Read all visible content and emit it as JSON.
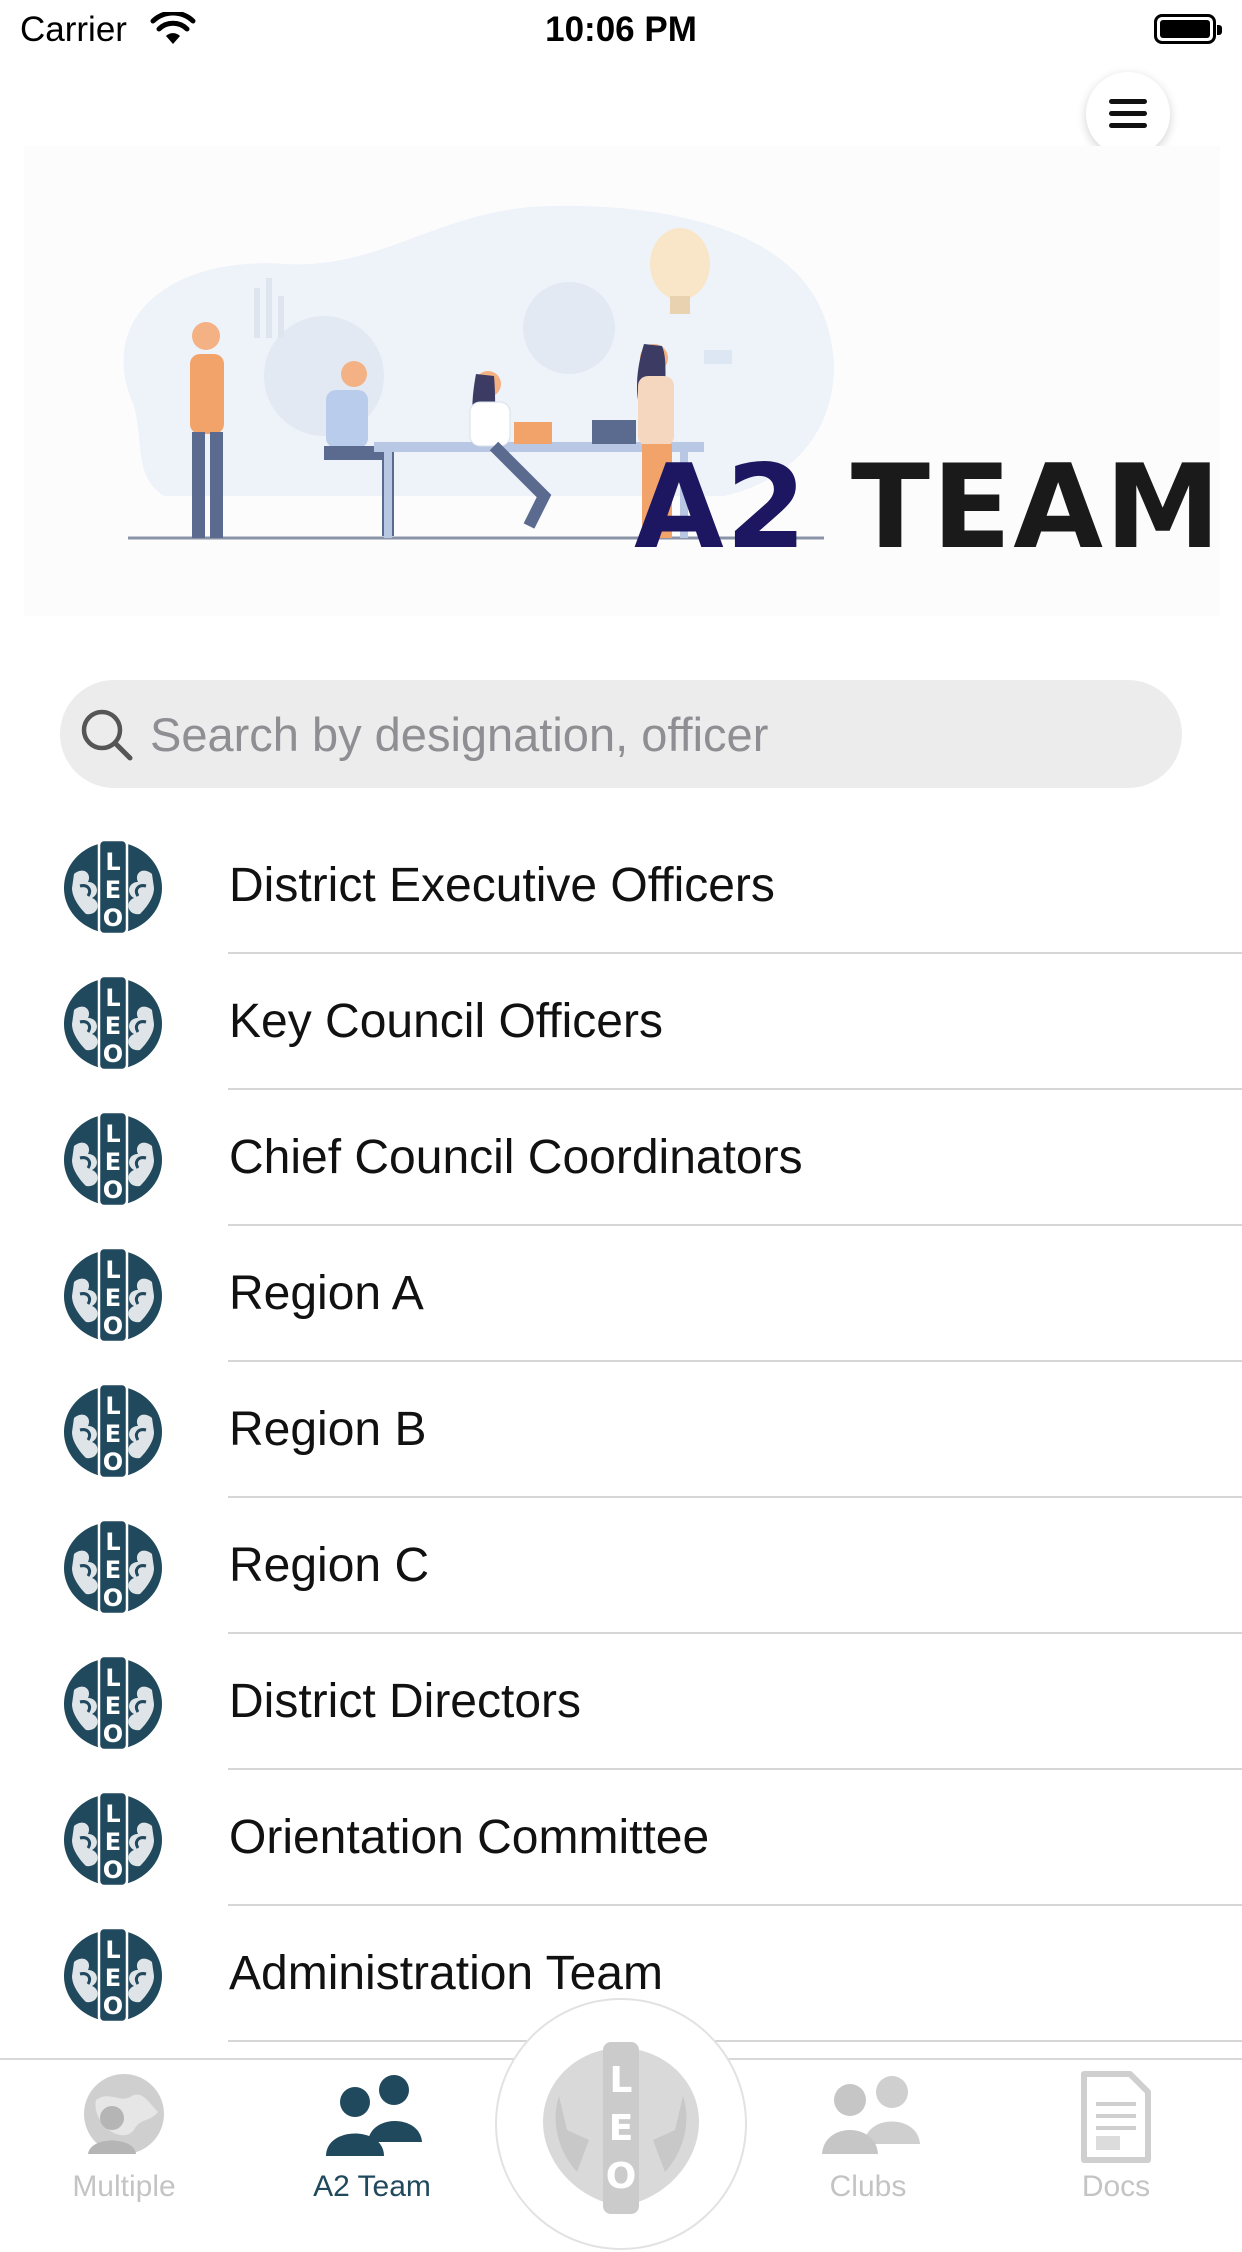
{
  "status_bar": {
    "carrier": "Carrier",
    "time": "10:06 PM"
  },
  "header": {
    "menu_icon": "hamburger-menu-icon"
  },
  "banner": {
    "title_part1": "A2",
    "title_part2": "TEAM"
  },
  "search": {
    "placeholder": "Search by designation, officer",
    "value": ""
  },
  "list": {
    "items": [
      {
        "label": "District Executive Officers",
        "icon": "leo-logo-icon"
      },
      {
        "label": "Key Council Officers",
        "icon": "leo-logo-icon"
      },
      {
        "label": "Chief Council Coordinators",
        "icon": "leo-logo-icon"
      },
      {
        "label": "Region A",
        "icon": "leo-logo-icon"
      },
      {
        "label": "Region B",
        "icon": "leo-logo-icon"
      },
      {
        "label": "Region C",
        "icon": "leo-logo-icon"
      },
      {
        "label": "District Directors",
        "icon": "leo-logo-icon"
      },
      {
        "label": "Orientation Committee",
        "icon": "leo-logo-icon"
      },
      {
        "label": "Administration Team",
        "icon": "leo-logo-icon"
      }
    ]
  },
  "tabbar": {
    "tabs": [
      {
        "label": "Multiple",
        "icon": "globe-person-icon",
        "active": false
      },
      {
        "label": "A2 Team",
        "icon": "team-icon",
        "active": true
      },
      {
        "label": "",
        "icon": "leo-logo-icon",
        "active": false
      },
      {
        "label": "Clubs",
        "icon": "group-icon",
        "active": false
      },
      {
        "label": "Docs",
        "icon": "document-icon",
        "active": false
      }
    ]
  },
  "colors": {
    "accent": "#21495d",
    "banner_title_dark": "#1d1660",
    "inactive_tab": "#c4c4c4"
  }
}
